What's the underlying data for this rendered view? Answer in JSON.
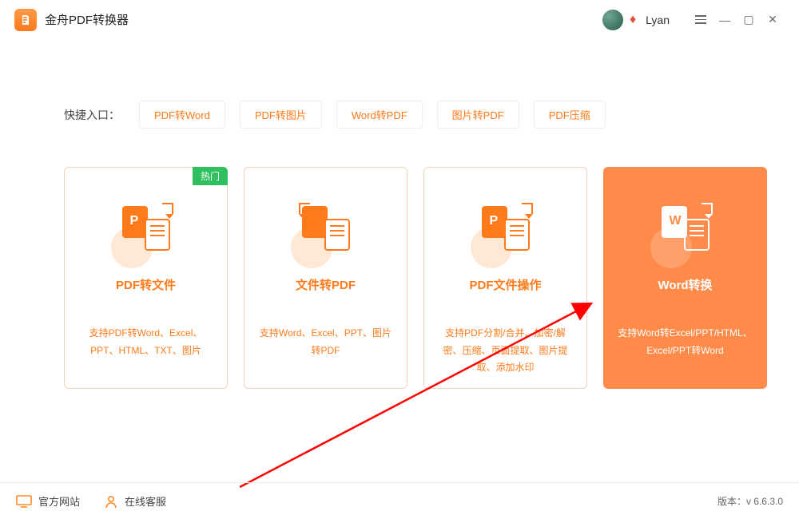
{
  "app": {
    "title": "金舟PDF转换器",
    "username": "Lyan"
  },
  "quick": {
    "label": "快捷入口：",
    "items": [
      "PDF转Word",
      "PDF转图片",
      "Word转PDF",
      "图片转PDF",
      "PDF压缩"
    ]
  },
  "cards": [
    {
      "title": "PDF转文件",
      "desc": "支持PDF转Word、Excel、PPT、HTML、TXT、图片",
      "badge": "热门",
      "letter": "P"
    },
    {
      "title": "文件转PDF",
      "desc": "支持Word、Excel、PPT、图片转PDF",
      "letter": ""
    },
    {
      "title": "PDF文件操作",
      "desc": "支持PDF分割/合并、加密/解密、压缩、页面提取、图片提取、添加水印",
      "letter": "P"
    },
    {
      "title": "Word转换",
      "desc": "支持Word转Excel/PPT/HTML、Excel/PPT转Word",
      "letter": "W",
      "active": true
    }
  ],
  "footer": {
    "official": "官方网站",
    "service": "在线客服",
    "version_label": "版本：",
    "version": "v 6.6.3.0"
  }
}
